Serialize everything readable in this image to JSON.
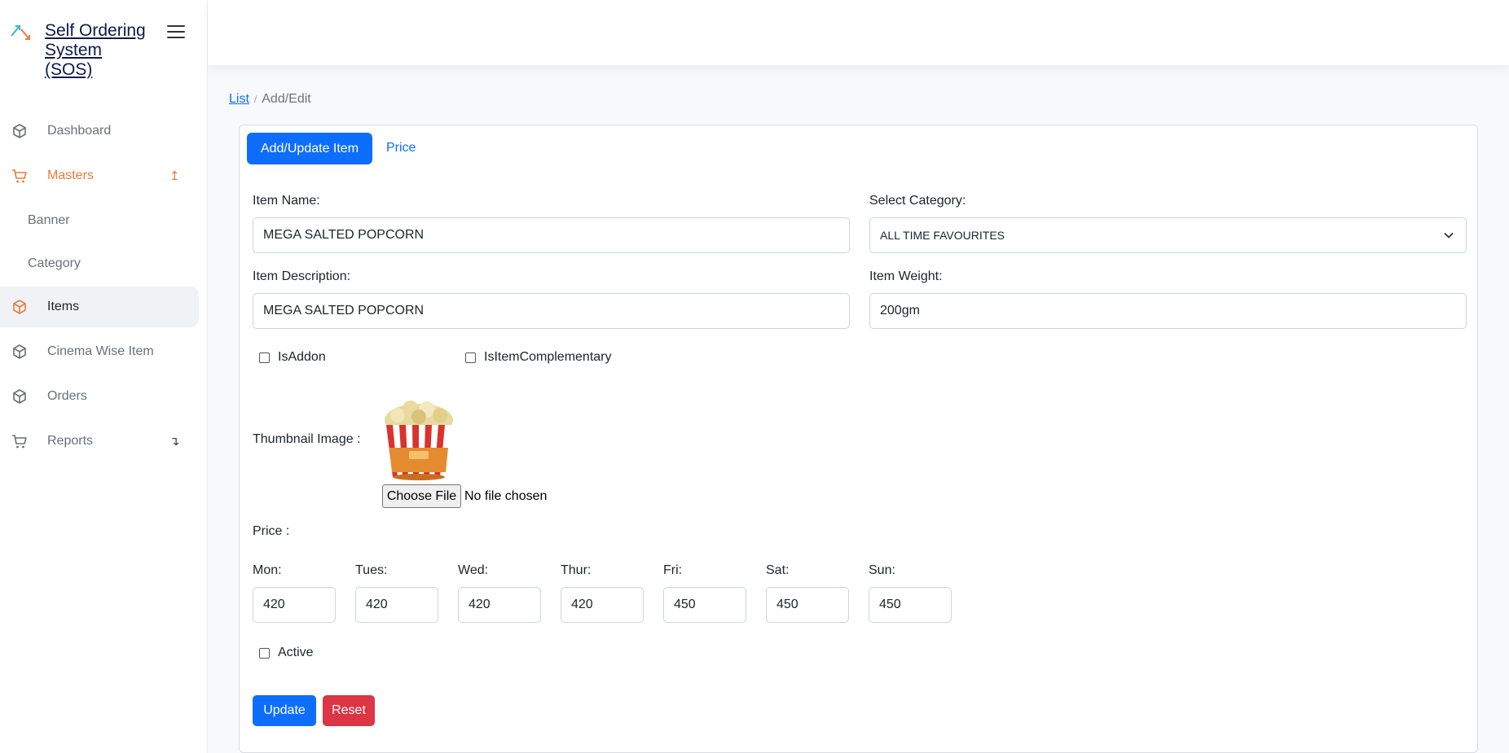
{
  "app": {
    "title": "Self Ordering System (SOS)"
  },
  "sidebar": {
    "items": [
      {
        "label": "Dashboard",
        "icon": "box-icon"
      },
      {
        "label": "Masters",
        "icon": "cart-icon",
        "arrow": "↥"
      },
      {
        "label": "Banner"
      },
      {
        "label": "Category"
      },
      {
        "label": "Items",
        "icon": "box-icon"
      },
      {
        "label": "Cinema Wise Item",
        "icon": "box-icon"
      },
      {
        "label": "Orders",
        "icon": "box-icon"
      },
      {
        "label": "Reports",
        "icon": "cart-icon",
        "arrow": "↴"
      }
    ]
  },
  "breadcrumb": {
    "link": "List",
    "separator": "/",
    "current": "Add/Edit"
  },
  "tabs": {
    "active": "Add/Update Item",
    "other": "Price"
  },
  "form": {
    "item_name_label": "Item Name:",
    "item_name_value": "MEGA SALTED POPCORN",
    "category_label": "Select Category:",
    "category_value": "ALL TIME FAVOURITES",
    "description_label": "Item Description:",
    "description_value": "MEGA SALTED POPCORN",
    "weight_label": "Item Weight:",
    "weight_value": "200gm",
    "is_addon_label": "IsAddon",
    "is_complementary_label": "IsItemComplementary",
    "thumbnail_label": "Thumbnail Image :",
    "choose_file_label": "Choose File",
    "file_status": "No file chosen",
    "price_label": "Price :",
    "prices": [
      {
        "day": "Mon:",
        "value": "420"
      },
      {
        "day": "Tues:",
        "value": "420"
      },
      {
        "day": "Wed:",
        "value": "420"
      },
      {
        "day": "Thur:",
        "value": "420"
      },
      {
        "day": "Fri:",
        "value": "450"
      },
      {
        "day": "Sat:",
        "value": "450"
      },
      {
        "day": "Sun:",
        "value": "450"
      }
    ],
    "active_label": "Active",
    "update_label": "Update",
    "reset_label": "Reset"
  },
  "colors": {
    "primary": "#0d6efd",
    "danger": "#dc3545",
    "accent": "#e87a3a"
  }
}
